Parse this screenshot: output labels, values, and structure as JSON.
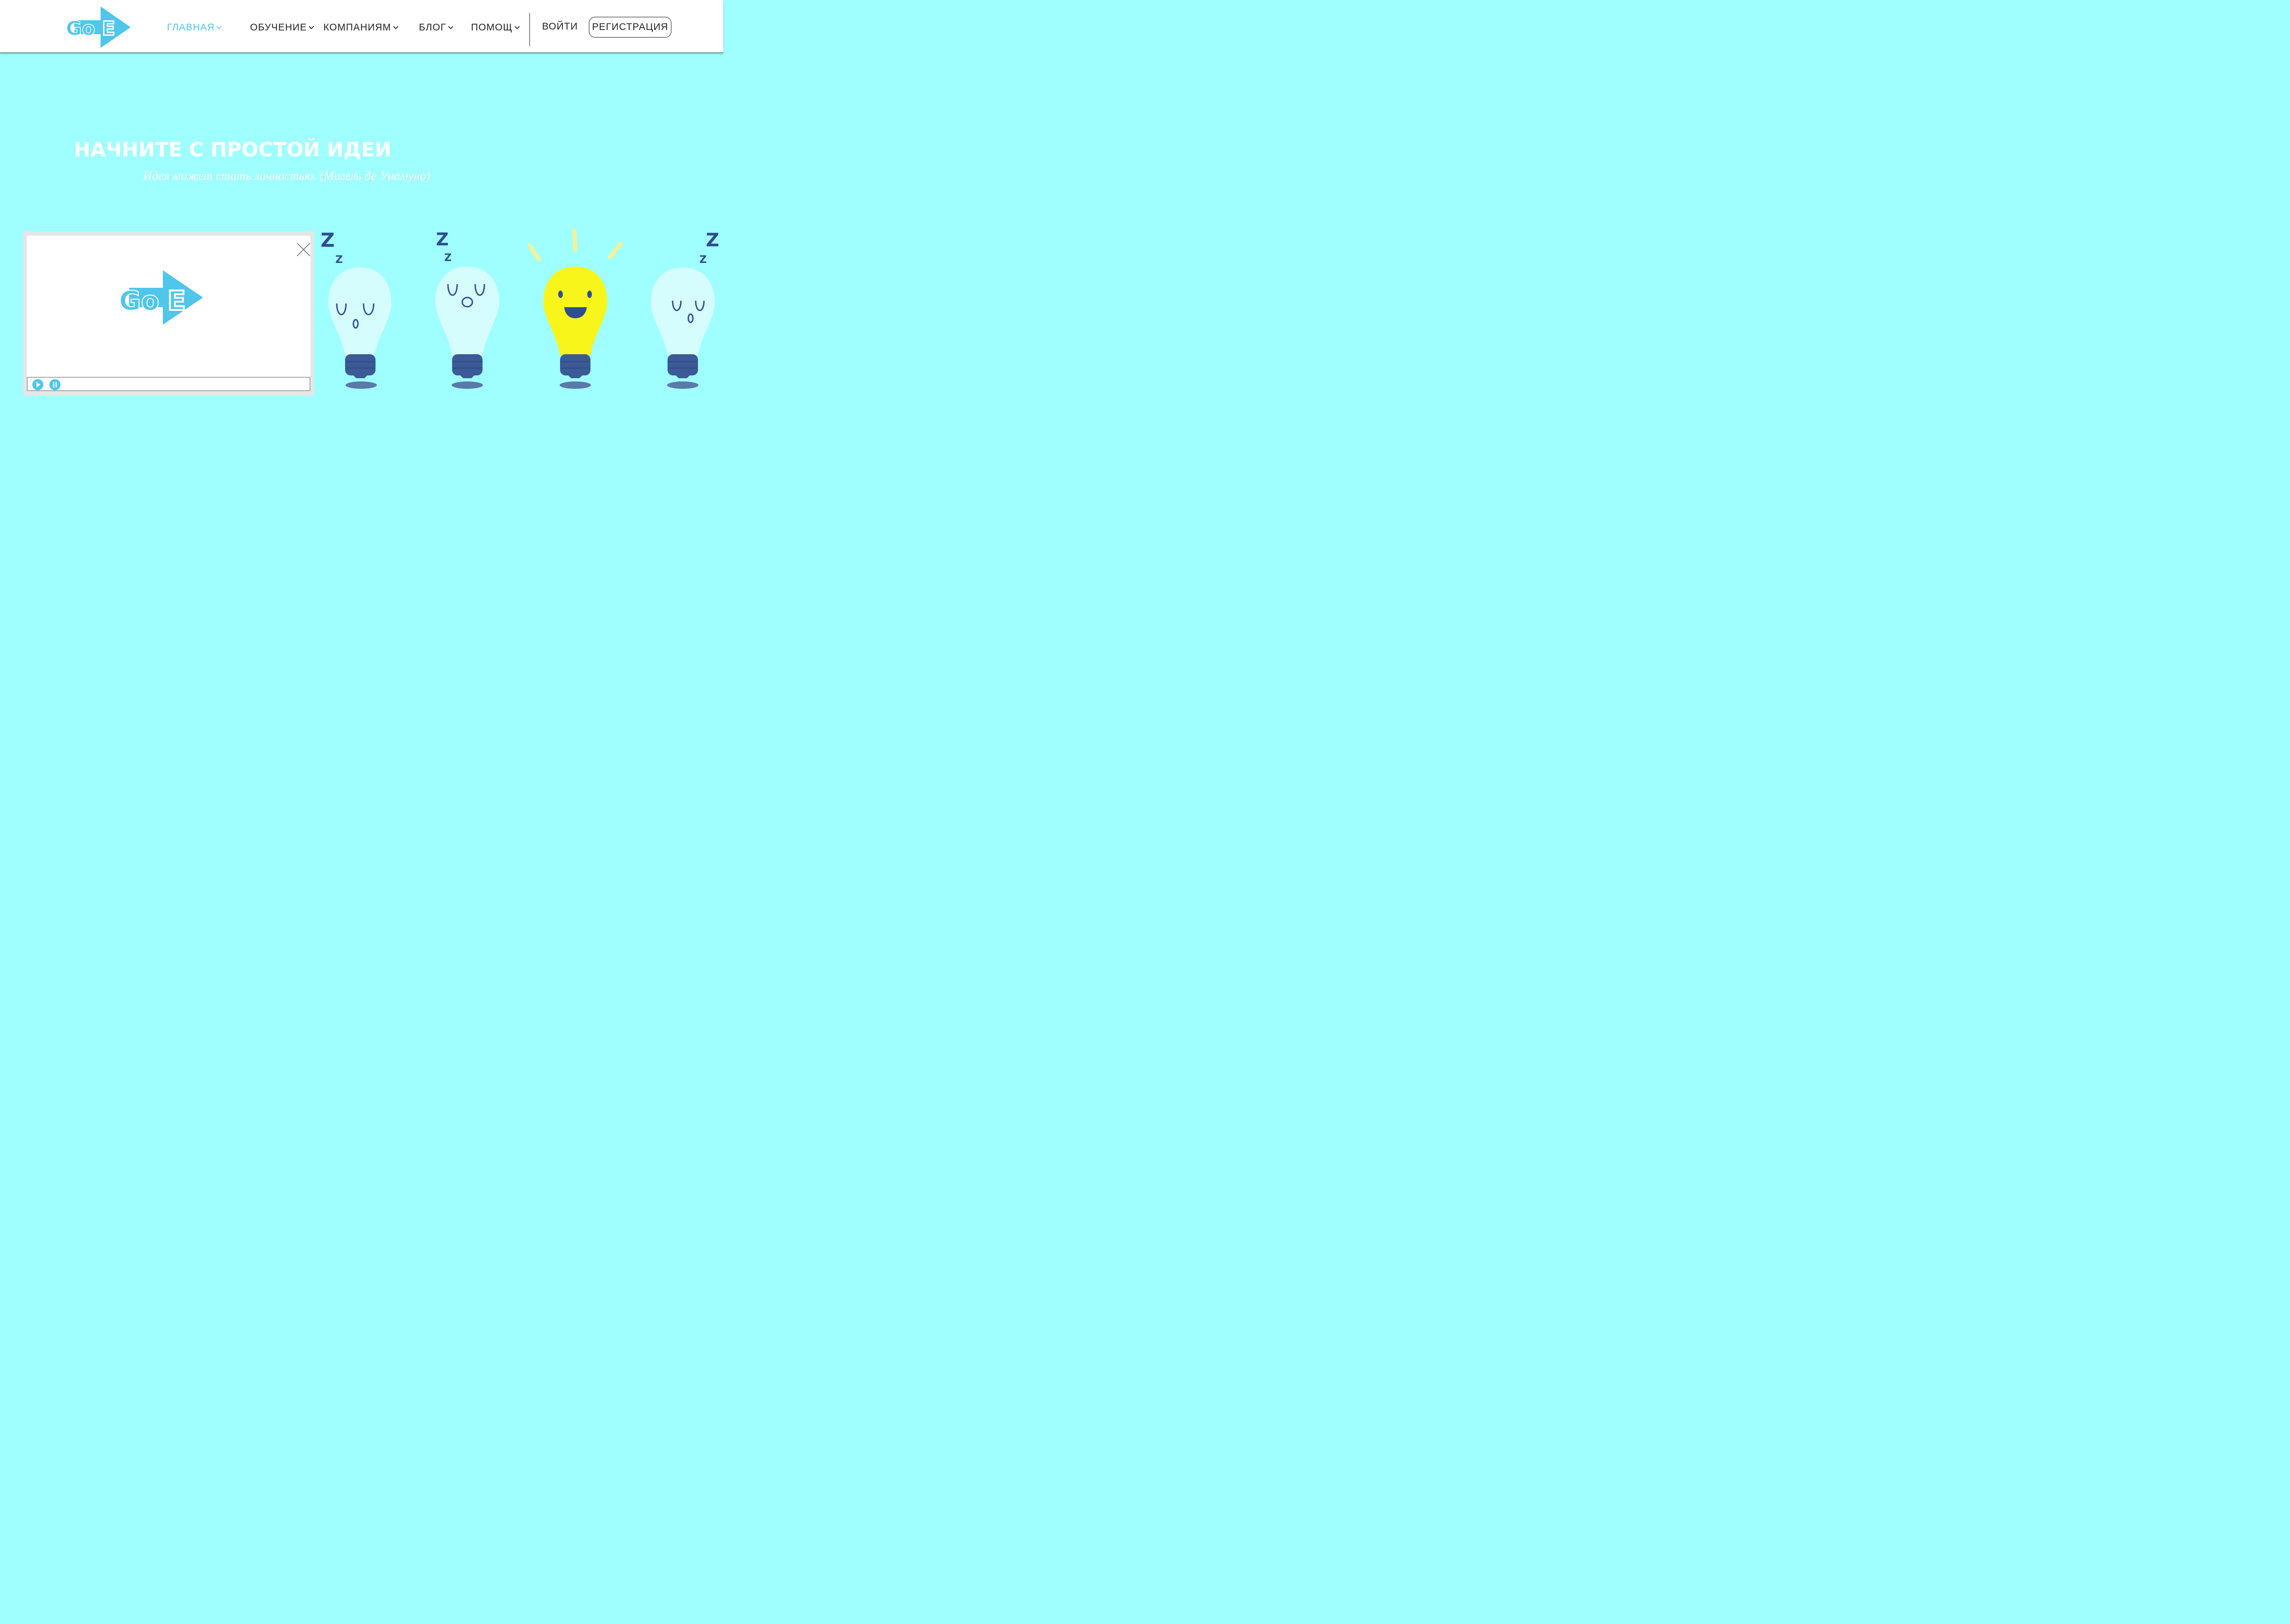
{
  "header": {
    "logo": {
      "letters_go": "Go",
      "letter_e": "E",
      "icon": "goe-arrow-logo"
    },
    "nav": [
      {
        "label": "ГЛАВНАЯ",
        "active": true
      },
      {
        "label": "ОБУЧЕНИЕ",
        "active": false
      },
      {
        "label": "КОМПАНИЯМ",
        "active": false
      },
      {
        "label": "БЛОГ",
        "active": false
      },
      {
        "label": "ПОМОЩ",
        "active": false
      }
    ],
    "login_label": "ВОЙТИ",
    "register_label": "РЕГИСТРАЦИЯ"
  },
  "hero": {
    "title": "НАЧНИТЕ С ПРОСТОЙ ИДЕИ",
    "quote": "Идея может стать личностью. (Мигель де Унамуно)"
  },
  "video_player": {
    "logo": {
      "letters_go": "Go",
      "letter_e": "E"
    },
    "icons": [
      "close-icon",
      "play-icon",
      "pause-icon"
    ]
  },
  "illustration": {
    "sleep_letter": "Z",
    "bulbs": [
      "sleeping",
      "sleeping",
      "awake",
      "sleeping"
    ]
  },
  "colors": {
    "background": "#9ffffe",
    "accent": "#4fc6ea",
    "bulb_glass": "#d5fdfd",
    "bulb_lit": "#f7f51a",
    "bulb_base": "#3b5a96"
  }
}
